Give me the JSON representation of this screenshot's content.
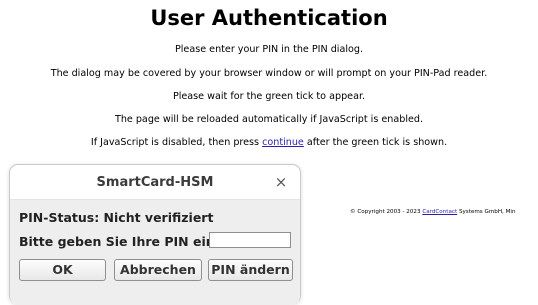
{
  "page": {
    "title": "User Authentication",
    "line1": "Please enter your PIN in the PIN dialog.",
    "line2": "The dialog may be covered by your browser window or will prompt on your PIN-Pad reader.",
    "line3": "Please wait for the green tick to appear.",
    "line4": "The page will be reloaded automatically if JavaScript is enabled.",
    "line5_before": "If JavaScript is disabled, then press ",
    "line5_link": "continue",
    "line5_after": " after the green tick is shown."
  },
  "footer": {
    "copyright_before": "© Copyright 2003 - 2023 ",
    "copyright_link": "CardContact",
    "copyright_after": " Systems GmbH, Min"
  },
  "dialog": {
    "title": "SmartCard-HSM",
    "close_glyph": "×",
    "pin_status": "PIN-Status: Nicht verifiziert",
    "pin_prompt": "Bitte geben Sie Ihre PIN ein",
    "pin_value": "",
    "ok_label": "OK",
    "cancel_label": "Abbrechen",
    "change_pin_label": "PIN ändern"
  },
  "colors": {
    "link": "#2a1fb0",
    "dialog_body": "#eeeeee"
  }
}
